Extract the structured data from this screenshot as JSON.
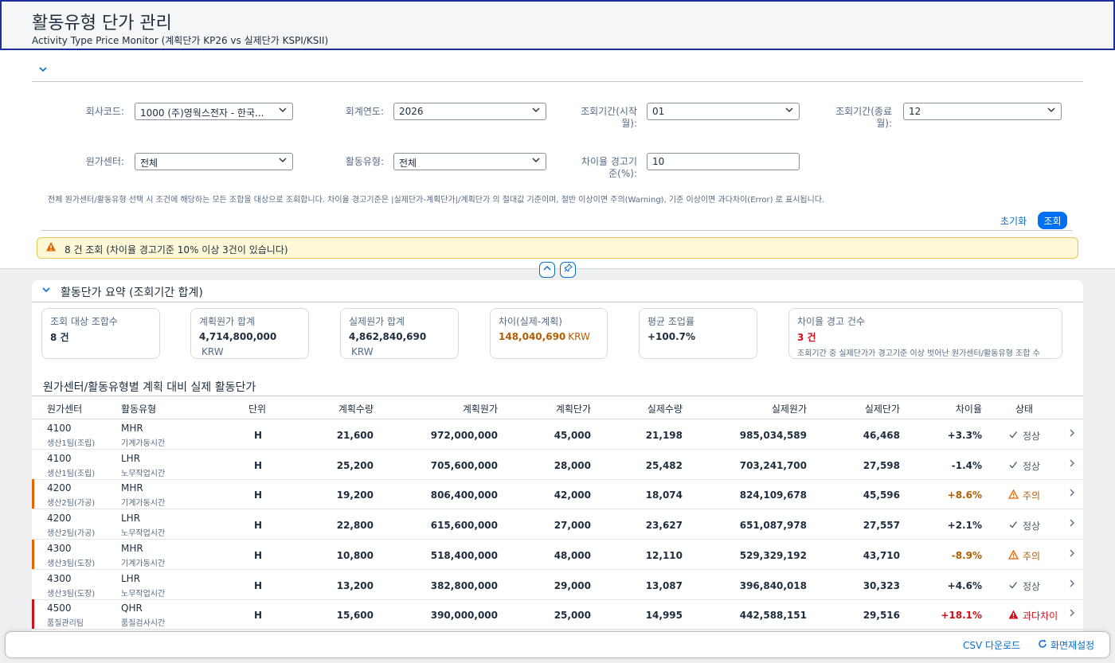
{
  "header": {
    "title": "활동유형 단가 관리",
    "subtitle": "Activity Type Price Monitor (계획단가 KP26 vs 실제단가 KSPI/KSII)"
  },
  "filters": {
    "company_label": "회사코드:",
    "company_value": "1000 (주)영웍스전자 - 한국...",
    "year_label": "회계연도:",
    "year_value": "2026",
    "period_from_label_1": "조회기간(시작",
    "period_from_label_2": "월):",
    "period_from_value": "01",
    "period_to_label_1": "조회기간(종료",
    "period_to_label_2": "월):",
    "period_to_value": "12",
    "costcenter_label": "원가센터:",
    "costcenter_value": "전체",
    "activity_label": "활동유형:",
    "activity_value": "전체",
    "threshold_label_1": "차이율 경고기",
    "threshold_label_2": "준(%):",
    "threshold_value": "10",
    "hint": "전체 원가센터/활동유형 선택 시 조건에 해당하는 모든 조합을 대상으로 조회합니다. 차이율 경고기준은 |실제단가-계획단가|/계획단가 의 절대값 기준이며, 절반 이상이면 주의(Warning), 기준 이상이면 과다차이(Error) 로 표시됩니다.",
    "reset_label": "초기화",
    "search_label": "조회"
  },
  "message_strip": "8 건 조회 (차이율 경고기준 10% 이상 3건이 있습니다)",
  "summary": {
    "title": "활동단가 요약 (조회기간 합계)",
    "cards": [
      {
        "label": "조회 대상 조합수",
        "value": "8 건",
        "unit": "",
        "note": ""
      },
      {
        "label": "계획원가 합계",
        "value": "4,714,800,000",
        "unit": "KRW",
        "note": ""
      },
      {
        "label": "실제원가 합계",
        "value": "4,862,840,690",
        "unit": "KRW",
        "note": ""
      },
      {
        "label": "차이(실제-계획)",
        "value": "148,040,690",
        "unit": "KRW",
        "note": ""
      },
      {
        "label": "평균 조업률",
        "value": "+100.7%",
        "unit": "",
        "note": ""
      },
      {
        "label": "차이율 경고 건수",
        "value": "3 건",
        "unit": "",
        "note": "조회기간 중 실제단가가 경고기준 이상 벗어난 원가센터/활동유형 조합 수"
      }
    ]
  },
  "table": {
    "title": "원가센터/활동유형별 계획 대비 실제 활동단가",
    "columns": [
      "원가센터",
      "활동유형",
      "단위",
      "계획수량",
      "계획원가",
      "계획단가",
      "실제수량",
      "실제원가",
      "실제단가",
      "차이율",
      "상태"
    ],
    "rows": [
      {
        "cc": "4100",
        "cc_name": "생산1팀(조립)",
        "act": "MHR",
        "act_name": "기계가동시간",
        "unit": "H",
        "plan_qty": "21,600",
        "plan_cost": "972,000,000",
        "plan_price": "45,000",
        "act_qty": "21,198",
        "act_cost": "985,034,589",
        "act_price": "46,468",
        "variance": "+3.3%",
        "status": "정상",
        "level": "ok"
      },
      {
        "cc": "4100",
        "cc_name": "생산1팀(조립)",
        "act": "LHR",
        "act_name": "노무작업시간",
        "unit": "H",
        "plan_qty": "25,200",
        "plan_cost": "705,600,000",
        "plan_price": "28,000",
        "act_qty": "25,482",
        "act_cost": "703,241,700",
        "act_price": "27,598",
        "variance": "-1.4%",
        "status": "정상",
        "level": "ok"
      },
      {
        "cc": "4200",
        "cc_name": "생산2팀(가공)",
        "act": "MHR",
        "act_name": "기계가동시간",
        "unit": "H",
        "plan_qty": "19,200",
        "plan_cost": "806,400,000",
        "plan_price": "42,000",
        "act_qty": "18,074",
        "act_cost": "824,109,678",
        "act_price": "45,596",
        "variance": "+8.6%",
        "status": "주의",
        "level": "warn"
      },
      {
        "cc": "4200",
        "cc_name": "생산2팀(가공)",
        "act": "LHR",
        "act_name": "노무작업시간",
        "unit": "H",
        "plan_qty": "22,800",
        "plan_cost": "615,600,000",
        "plan_price": "27,000",
        "act_qty": "23,627",
        "act_cost": "651,087,978",
        "act_price": "27,557",
        "variance": "+2.1%",
        "status": "정상",
        "level": "ok"
      },
      {
        "cc": "4300",
        "cc_name": "생산3팀(도장)",
        "act": "MHR",
        "act_name": "기계가동시간",
        "unit": "H",
        "plan_qty": "10,800",
        "plan_cost": "518,400,000",
        "plan_price": "48,000",
        "act_qty": "12,110",
        "act_cost": "529,329,192",
        "act_price": "43,710",
        "variance": "-8.9%",
        "status": "주의",
        "level": "warn"
      },
      {
        "cc": "4300",
        "cc_name": "생산3팀(도장)",
        "act": "LHR",
        "act_name": "노무작업시간",
        "unit": "H",
        "plan_qty": "13,200",
        "plan_cost": "382,800,000",
        "plan_price": "29,000",
        "act_qty": "13,087",
        "act_cost": "396,840,018",
        "act_price": "30,323",
        "variance": "+4.6%",
        "status": "정상",
        "level": "ok"
      },
      {
        "cc": "4500",
        "cc_name": "품질관리팀",
        "act": "QHR",
        "act_name": "품질검사시간",
        "unit": "H",
        "plan_qty": "15,600",
        "plan_cost": "390,000,000",
        "plan_price": "25,000",
        "act_qty": "14,995",
        "act_cost": "442,588,151",
        "act_price": "29,516",
        "variance": "+18.1%",
        "status": "과다차이",
        "level": "err"
      }
    ]
  },
  "footer": {
    "csv_label": "CSV 다운로드",
    "reload_label": "화면재설정"
  },
  "icons": {
    "ok": "checkmark-icon",
    "warn": "warning-triangle-icon",
    "err": "error-triangle-icon"
  },
  "colors": {
    "accent": "#0070f2",
    "warning": "#e76500",
    "error": "#d1101b",
    "header_border": "#1c2f9c"
  }
}
